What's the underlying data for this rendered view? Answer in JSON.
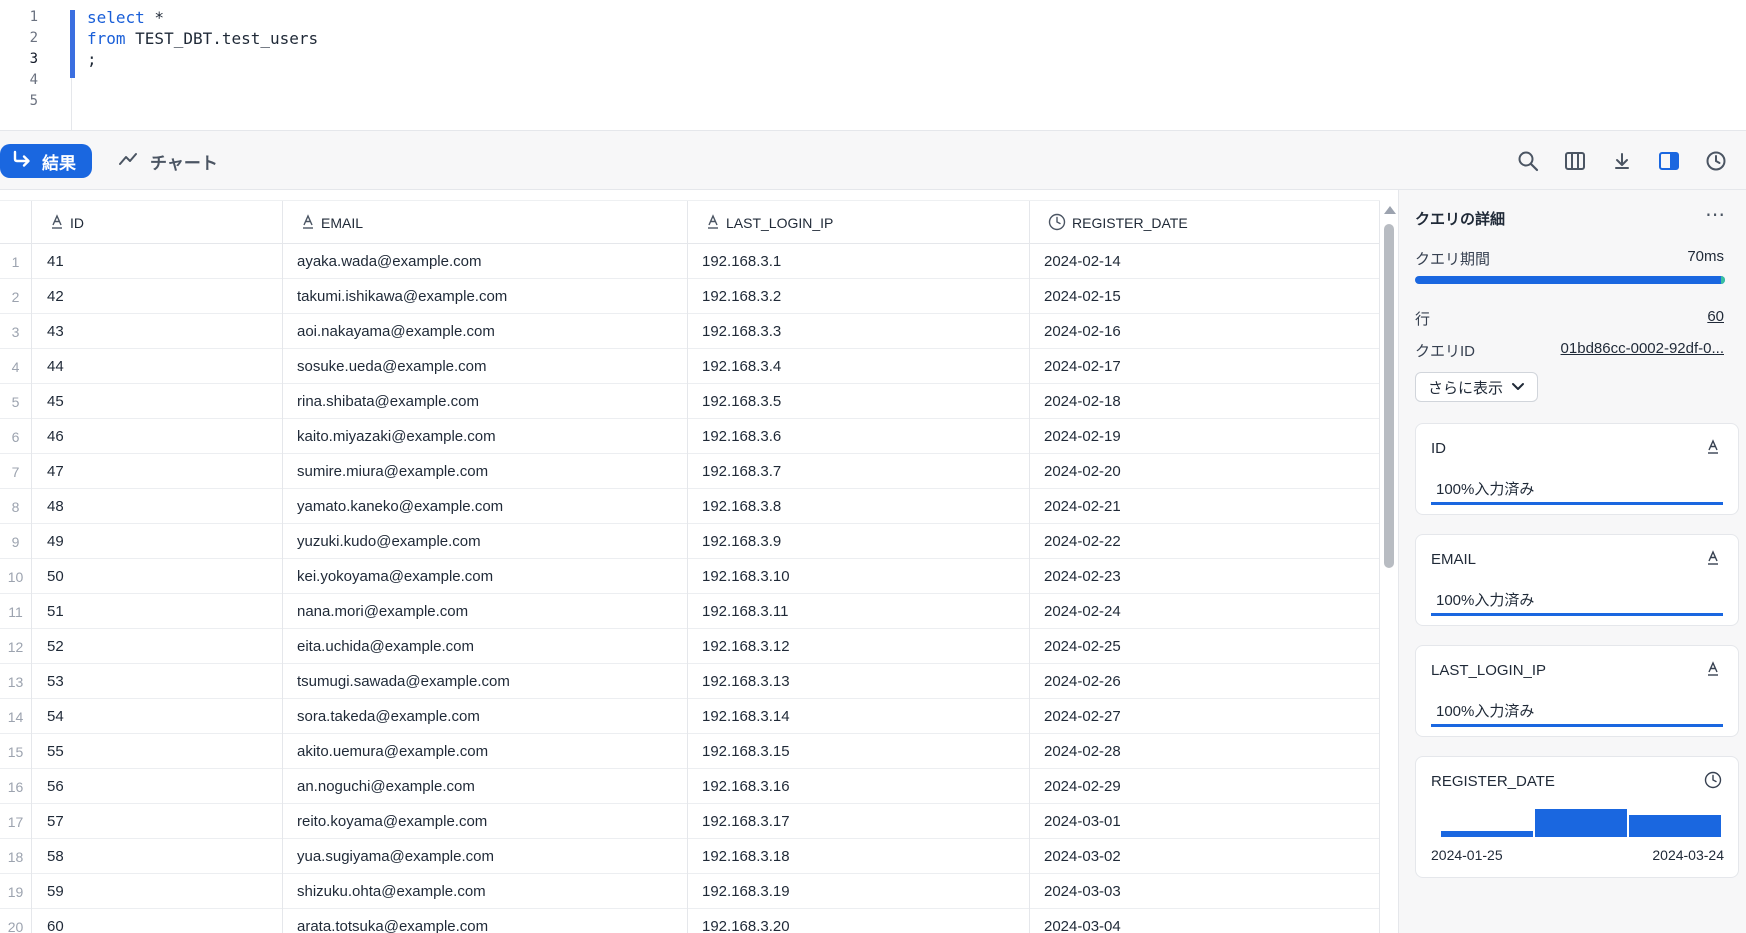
{
  "editor": {
    "lines": [
      {
        "num": "1",
        "kw": "select",
        "rest": " *"
      },
      {
        "num": "2",
        "kw": "from",
        "rest": " TEST_DBT.test_users"
      },
      {
        "num": "3",
        "kw": "",
        "rest": ";"
      },
      {
        "num": "4",
        "kw": "",
        "rest": ""
      },
      {
        "num": "5",
        "kw": "",
        "rest": ""
      }
    ]
  },
  "toolbar": {
    "results_label": "結果",
    "chart_label": "チャート",
    "icons": [
      "search-icon",
      "columns-icon",
      "download-icon",
      "split-panel-icon",
      "history-icon"
    ]
  },
  "grid": {
    "columns": [
      {
        "name": "ID",
        "type_icon": "text-type-icon"
      },
      {
        "name": "EMAIL",
        "type_icon": "text-type-icon"
      },
      {
        "name": "LAST_LOGIN_IP",
        "type_icon": "text-type-icon"
      },
      {
        "name": "REGISTER_DATE",
        "type_icon": "clock-type-icon"
      }
    ],
    "rows": [
      [
        "1",
        "41",
        "ayaka.wada@example.com",
        "192.168.3.1",
        "2024-02-14"
      ],
      [
        "2",
        "42",
        "takumi.ishikawa@example.com",
        "192.168.3.2",
        "2024-02-15"
      ],
      [
        "3",
        "43",
        "aoi.nakayama@example.com",
        "192.168.3.3",
        "2024-02-16"
      ],
      [
        "4",
        "44",
        "sosuke.ueda@example.com",
        "192.168.3.4",
        "2024-02-17"
      ],
      [
        "5",
        "45",
        "rina.shibata@example.com",
        "192.168.3.5",
        "2024-02-18"
      ],
      [
        "6",
        "46",
        "kaito.miyazaki@example.com",
        "192.168.3.6",
        "2024-02-19"
      ],
      [
        "7",
        "47",
        "sumire.miura@example.com",
        "192.168.3.7",
        "2024-02-20"
      ],
      [
        "8",
        "48",
        "yamato.kaneko@example.com",
        "192.168.3.8",
        "2024-02-21"
      ],
      [
        "9",
        "49",
        "yuzuki.kudo@example.com",
        "192.168.3.9",
        "2024-02-22"
      ],
      [
        "10",
        "50",
        "kei.yokoyama@example.com",
        "192.168.3.10",
        "2024-02-23"
      ],
      [
        "11",
        "51",
        "nana.mori@example.com",
        "192.168.3.11",
        "2024-02-24"
      ],
      [
        "12",
        "52",
        "eita.uchida@example.com",
        "192.168.3.12",
        "2024-02-25"
      ],
      [
        "13",
        "53",
        "tsumugi.sawada@example.com",
        "192.168.3.13",
        "2024-02-26"
      ],
      [
        "14",
        "54",
        "sora.takeda@example.com",
        "192.168.3.14",
        "2024-02-27"
      ],
      [
        "15",
        "55",
        "akito.uemura@example.com",
        "192.168.3.15",
        "2024-02-28"
      ],
      [
        "16",
        "56",
        "an.noguchi@example.com",
        "192.168.3.16",
        "2024-02-29"
      ],
      [
        "17",
        "57",
        "reito.koyama@example.com",
        "192.168.3.17",
        "2024-03-01"
      ],
      [
        "18",
        "58",
        "yua.sugiyama@example.com",
        "192.168.3.18",
        "2024-03-02"
      ],
      [
        "19",
        "59",
        "shizuku.ohta@example.com",
        "192.168.3.19",
        "2024-03-03"
      ],
      [
        "20",
        "60",
        "arata.totsuka@example.com",
        "192.168.3.20",
        "2024-03-04"
      ]
    ]
  },
  "panel": {
    "title": "クエリの詳細",
    "more_icon": "more-horizontal-icon",
    "duration_label": "クエリ期間",
    "duration_value": "70ms",
    "duration_fraction": 1.0,
    "rows_label": "行",
    "rows_value": "60",
    "query_id_label": "クエリID",
    "query_id_value": "01bd86cc-0002-92df-0...",
    "show_more_label": "さらに表示",
    "cards": [
      {
        "name": "ID",
        "fill_label": "100%入力済み",
        "fill_fraction": 1.0,
        "type_icon": "text-type-icon"
      },
      {
        "name": "EMAIL",
        "fill_label": "100%入力済み",
        "fill_fraction": 1.0,
        "type_icon": "text-type-icon"
      },
      {
        "name": "LAST_LOGIN_IP",
        "fill_label": "100%入力済み",
        "fill_fraction": 1.0,
        "type_icon": "text-type-icon"
      }
    ],
    "date_card": {
      "name": "REGISTER_DATE",
      "type_icon": "clock-type-icon",
      "range_start": "2024-01-25",
      "range_end": "2024-03-24",
      "histogram": [
        0.2,
        1.0,
        0.8
      ]
    }
  },
  "colors": {
    "accent": "#1a67e0",
    "keyword": "#1a5fd8",
    "duration_tip": "#3ac0a0"
  }
}
